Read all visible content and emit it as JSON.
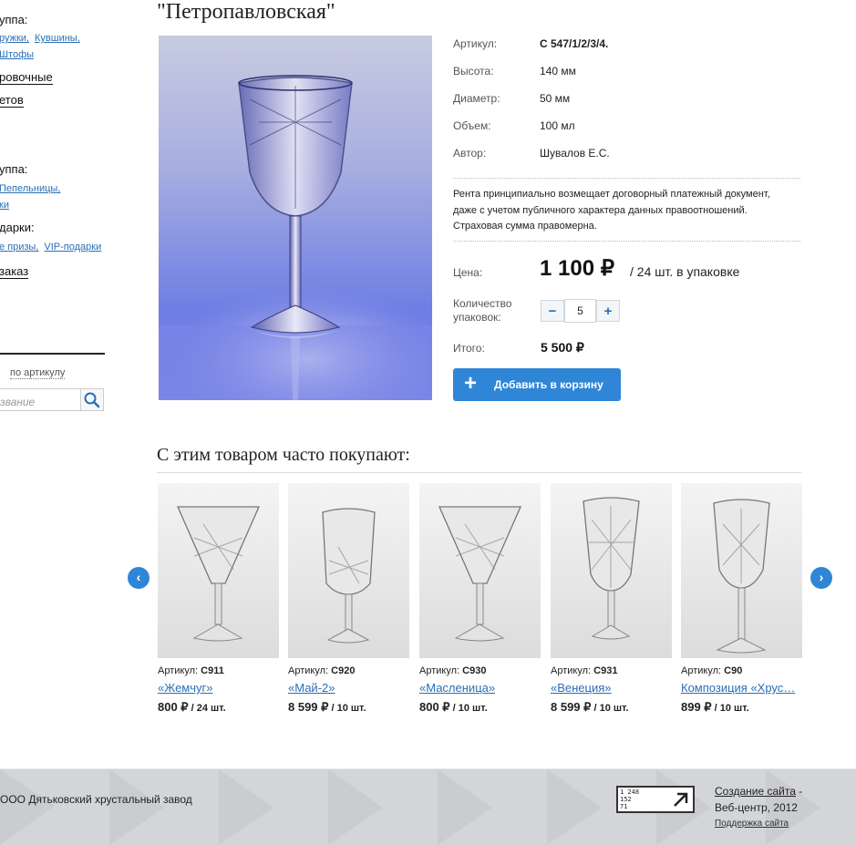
{
  "sidebar": {
    "group1_heading": "уппа:",
    "group1_links": [
      "ружки,",
      "Кувшины,",
      "Штофы"
    ],
    "item_dinnerware": "ровочные",
    "item_colored": "етов",
    "group2_heading": "уппа:",
    "group2_links": [
      "Пепельницы,",
      "ки"
    ],
    "gifts_heading": "дарки:",
    "gifts_links": [
      "е призы,",
      "VIP-подарки"
    ],
    "order_link": "заказ",
    "search_tab": "по артикулу",
    "search_placeholder": "звание"
  },
  "product": {
    "title": "\"Петропавловская\"",
    "specs": [
      {
        "label": "Артикул:",
        "value": "С 547/1/2/3/4."
      },
      {
        "label": "Высота:",
        "value": "140 мм"
      },
      {
        "label": "Диаметр:",
        "value": "50 мм"
      },
      {
        "label": "Объем:",
        "value": "100 мл"
      },
      {
        "label": "Автор:",
        "value": "Шувалов Е.С."
      }
    ],
    "description": "Рента принципиально возмещает договорный платежный документ, даже с учетом публичного характера данных правоотношений. Страховая сумма правомерна.",
    "price_label": "Цена:",
    "price": "1 100 ₽",
    "price_unit": "/ 24 шт. в упаковке",
    "qty_label": "Количество упаковок:",
    "qty_minus": "−",
    "qty_value": "5",
    "qty_plus": "+",
    "total_label": "Итого:",
    "total": "5 500 ₽",
    "add_icon": "+",
    "add_button": "Добавить в корзину"
  },
  "related": {
    "heading": "С этим товаром часто покупают:",
    "prev_icon": "‹",
    "next_icon": "›",
    "items": [
      {
        "art_label": "Артикул:",
        "art": "С911",
        "name": "«Жемчуг»",
        "price": "800 ₽",
        "unit": " / 24 шт."
      },
      {
        "art_label": "Артикул:",
        "art": "С920",
        "name": "«Май-2»",
        "price": "8 599 ₽",
        "unit": " / 10 шт."
      },
      {
        "art_label": "Артикул:",
        "art": "С930",
        "name": "«Масленица»",
        "price": "800 ₽",
        "unit": " / 10 шт."
      },
      {
        "art_label": "Артикул:",
        "art": "С931",
        "name": "«Венеция»",
        "price": "8 599 ₽",
        "unit": " / 10 шт."
      },
      {
        "art_label": "Артикул:",
        "art": "С90",
        "name": "Композиция «Хрус…",
        "price": "899 ₽",
        "unit": " / 10 шт."
      }
    ]
  },
  "footer": {
    "company": "ООО Дятьковский хрустальный завод",
    "counter_lines": [
      "1 248",
      "152",
      "71"
    ],
    "credit_link": "Создание сайта",
    "credit_dash": " -",
    "credit_line2": "Веб-центр, 2012",
    "support_link": "Поддержка сайта"
  },
  "colors": {
    "accent": "#2f86d6",
    "link": "#2a6fb5",
    "footer_bg": "#d3d5d8"
  }
}
